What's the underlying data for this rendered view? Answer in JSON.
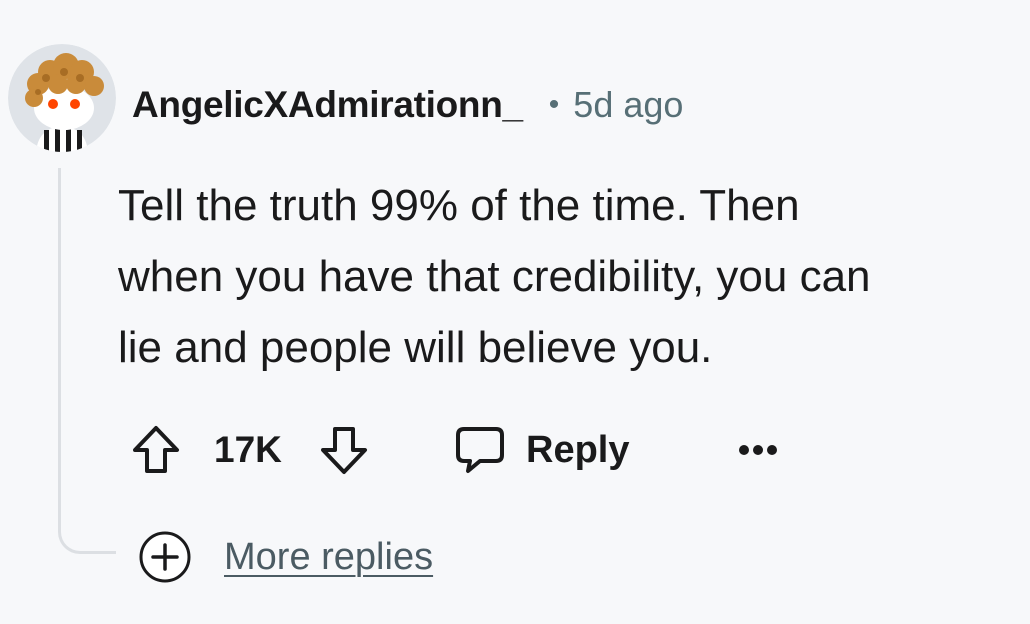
{
  "comment": {
    "username": "AngelicXAdmirationn_",
    "separator": "•",
    "time": "5d ago",
    "body_lines": [
      "Tell the truth 99% of the time. Then",
      "when you have that credibility, you can",
      "lie and people will believe you."
    ],
    "score": "17K",
    "reply_label": "Reply"
  },
  "thread": {
    "more_replies_label": "More replies"
  },
  "icons": {
    "upvote": "arrow-up-icon",
    "downvote": "arrow-down-icon",
    "reply": "speech-bubble-icon",
    "overflow": "ellipsis-icon",
    "expand": "plus-circle-icon"
  },
  "colors": {
    "background": "#f7f8fa",
    "text": "#1a1a1b",
    "meta": "#576f76",
    "thread_line": "#dcdfe3"
  }
}
